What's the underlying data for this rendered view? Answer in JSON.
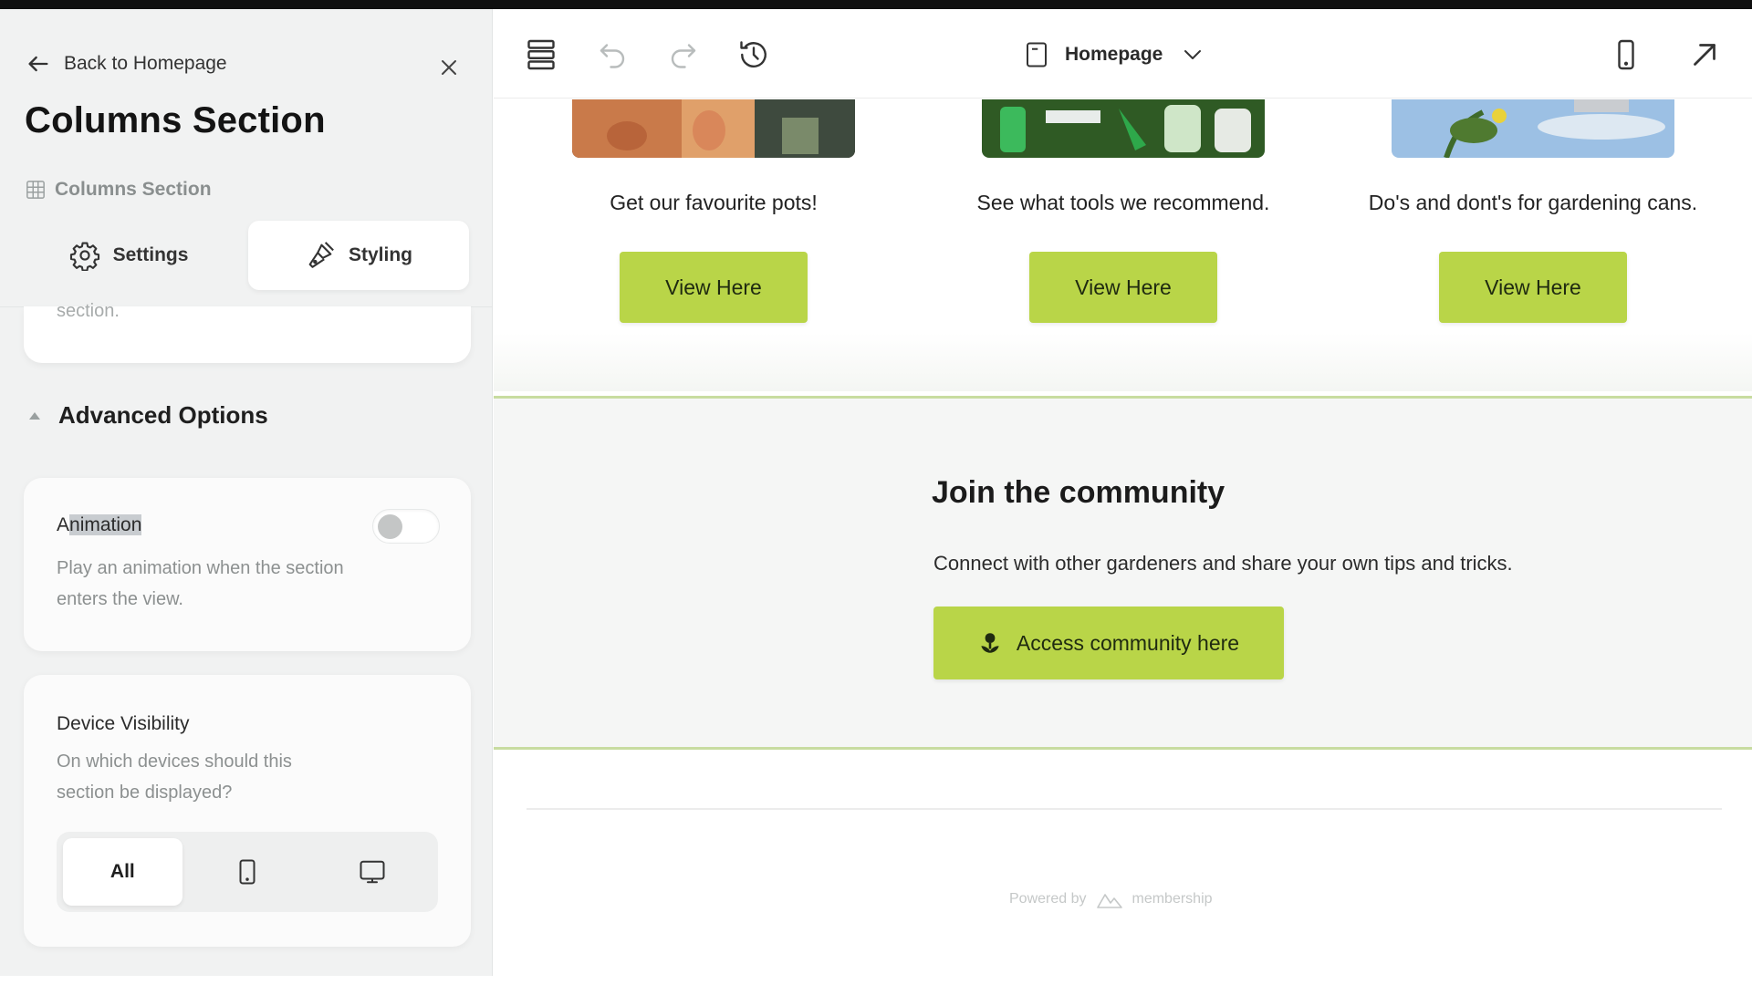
{
  "sidebar": {
    "back_label": "Back to Homepage",
    "title": "Columns Section",
    "breadcrumb": "Columns Section",
    "tabs": [
      {
        "label": "Settings",
        "active": false
      },
      {
        "label": "Styling",
        "active": true
      }
    ],
    "cut_text": "section.",
    "advanced_options": "Advanced Options",
    "animation": {
      "label_prefix": "A",
      "label_selected": "nimation",
      "description": "Play an animation when the section enters the view.",
      "enabled": false
    },
    "device_visibility": {
      "label": "Device Visibility",
      "description": "On which devices should this section be displayed?",
      "options": [
        "All"
      ],
      "selected": "All"
    }
  },
  "toolbar": {
    "page_name": "Homepage"
  },
  "canvas": {
    "columns": [
      {
        "text": "Get our favourite pots!",
        "button": "View Here"
      },
      {
        "text": "See what tools we recommend.",
        "button": "View Here"
      },
      {
        "text": "Do's and dont's for gardening cans.",
        "button": "View Here"
      }
    ],
    "community": {
      "title": "Join the community",
      "text": "Connect with other gardeners and share your own tips and tricks.",
      "button": "Access community here"
    },
    "footer": {
      "powered_by": "Powered by",
      "brand": "membership"
    }
  },
  "colors": {
    "accent_green": "#b9d548",
    "divider_green": "#c8dca0",
    "sidebar_bg": "#f1f2f2"
  }
}
